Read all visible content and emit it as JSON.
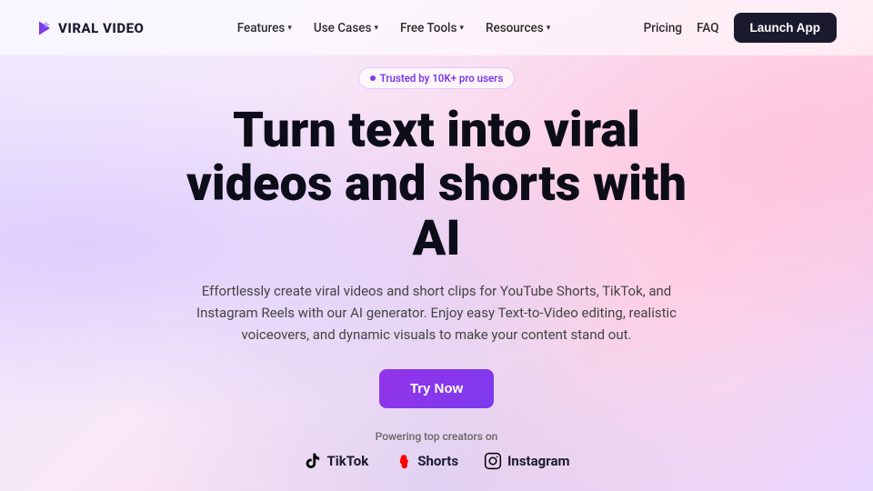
{
  "brand": {
    "name": "VIRAL VIDEO",
    "logo_alt": "viral video logo"
  },
  "nav": {
    "links": [
      {
        "label": "Features",
        "has_dropdown": true
      },
      {
        "label": "Use Cases",
        "has_dropdown": true
      },
      {
        "label": "Free Tools",
        "has_dropdown": true
      },
      {
        "label": "Resources",
        "has_dropdown": true
      }
    ],
    "pricing": "Pricing",
    "faq": "FAQ",
    "launch_btn": "Launch App"
  },
  "hero": {
    "trust_badge": "Trusted by 10K+ pro users",
    "title_line1": "Turn text into viral",
    "title_line2": "videos and shorts with",
    "title_line3": "AI",
    "subtitle": "Effortlessly create viral videos and short clips for YouTube Shorts, TikTok, and Instagram Reels with our AI generator. Enjoy easy Text-to-Video editing, realistic voiceovers, and dynamic visuals to make your content stand out.",
    "cta_btn": "Try Now",
    "powering_text": "Powering top creators on"
  },
  "platforms": [
    {
      "name": "TikTok",
      "icon": "tiktok"
    },
    {
      "name": "Shorts",
      "icon": "shorts"
    },
    {
      "name": "Instagram",
      "icon": "instagram"
    }
  ],
  "colors": {
    "accent": "#7c3aed",
    "dark": "#1a1a2e"
  }
}
